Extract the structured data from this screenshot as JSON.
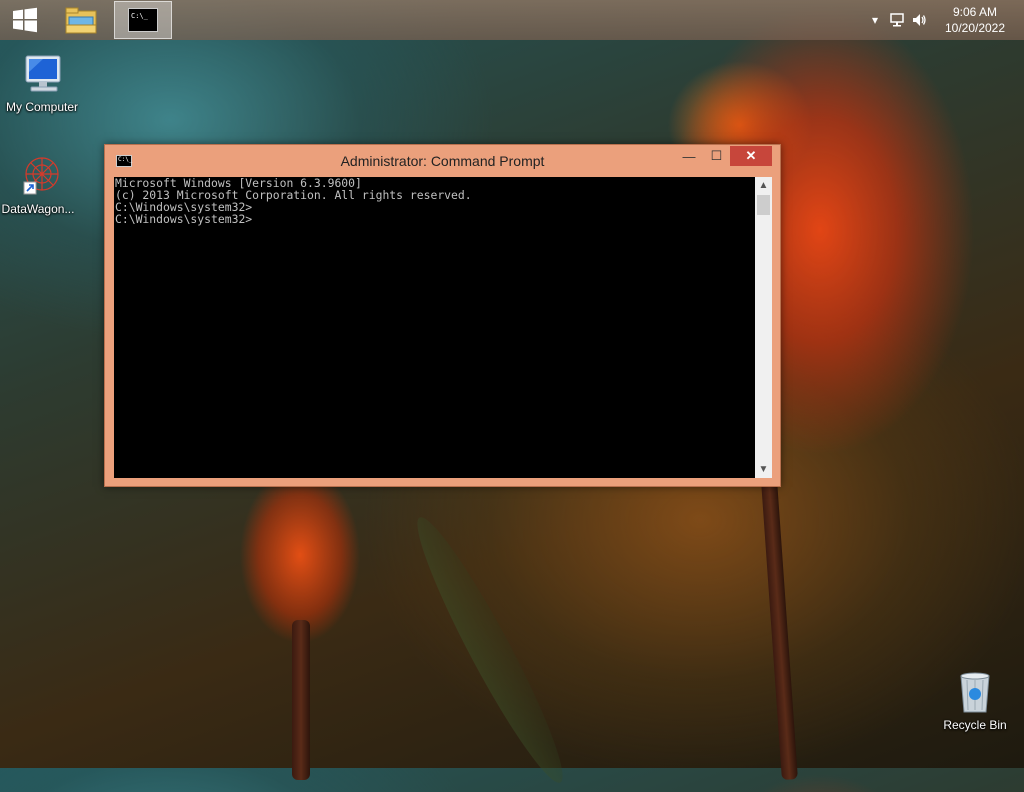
{
  "taskbar": {
    "start_icon": "windows-logo-icon",
    "pinned": [
      {
        "name": "file-explorer",
        "icon": "folder-icon"
      },
      {
        "name": "command-prompt",
        "icon": "cmd-icon",
        "active": true
      }
    ],
    "tray": {
      "overflow_icon": "chevron-up-icon",
      "network_icon": "network-icon",
      "volume_icon": "speaker-icon",
      "time": "9:06 AM",
      "date": "10/20/2022"
    }
  },
  "desktop": {
    "icons": [
      {
        "label": "My Computer",
        "icon": "computer-icon"
      },
      {
        "label": "DataWagon...",
        "icon": "datawagon-shortcut-icon"
      },
      {
        "label": "Recycle Bin",
        "icon": "recycle-bin-icon"
      }
    ]
  },
  "window": {
    "title": "Administrator: Command Prompt",
    "icon": "cmd-icon",
    "icon_text": "C:\\_",
    "minimize_glyph": "—",
    "maximize_glyph": "☐",
    "close_glyph": "✕",
    "console_lines": [
      "Microsoft Windows [Version 6.3.9600]",
      "(c) 2013 Microsoft Corporation. All rights reserved.",
      "C:\\Windows\\system32>",
      "C:\\Windows\\system32>"
    ],
    "scroll_up_glyph": "▲",
    "scroll_down_glyph": "▼"
  },
  "colors": {
    "window_frame": "#eba07c",
    "close_button": "#c7463b",
    "console_bg": "#000000",
    "console_text": "#c0c0c0"
  }
}
